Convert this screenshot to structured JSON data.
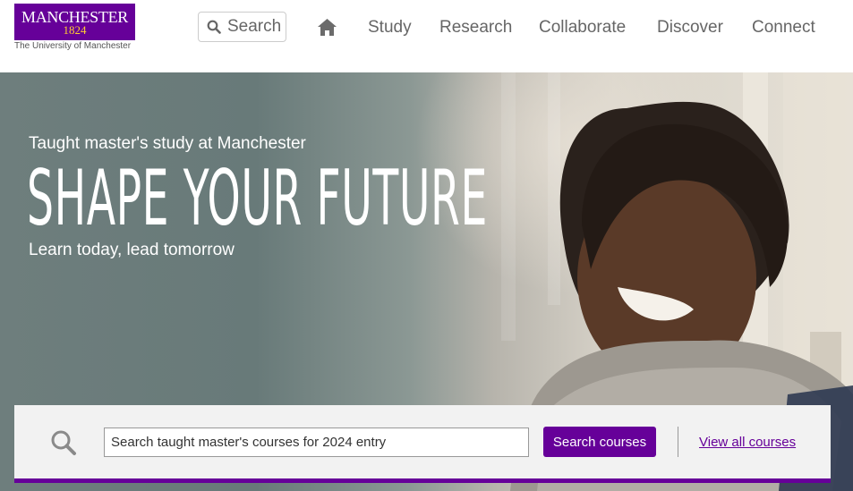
{
  "brand": {
    "name": "MANCHESTER",
    "year": "1824",
    "subtitle": "The University of Manchester",
    "primary_color": "#660099",
    "accent_color": "#ffcc33"
  },
  "header": {
    "search_label": "Search",
    "search_icon": "search-icon",
    "home_icon": "home-icon",
    "nav": [
      "Study",
      "Research",
      "Collaborate",
      "Discover",
      "Connect"
    ]
  },
  "hero": {
    "kicker": "Taught master's study at Manchester",
    "title": "SHAPE YOUR FUTURE",
    "subtitle": "Learn today, lead tomorrow"
  },
  "course_search": {
    "icon": "search-icon",
    "placeholder": "Search taught master's courses for 2024 entry",
    "value": "",
    "button_label": "Search courses",
    "view_all_label": "View all courses"
  }
}
